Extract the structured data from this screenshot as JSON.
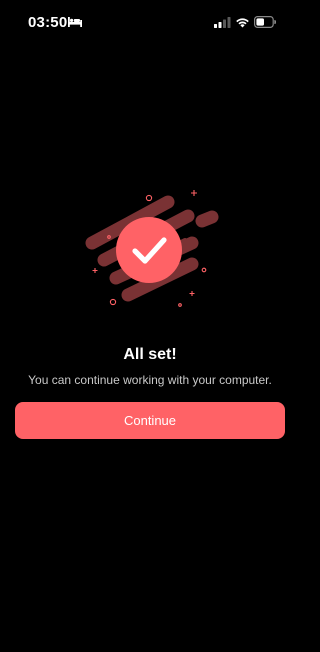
{
  "status_bar": {
    "time": "03:50",
    "icons": [
      "bed-icon",
      "cellular-signal-icon",
      "wifi-icon",
      "battery-icon"
    ]
  },
  "illustration": {
    "icon": "checkmark-icon",
    "accent_color": "#ff6266",
    "stripe_color": "#7a3234"
  },
  "main": {
    "title": "All set!",
    "subtitle": "You can continue working with your computer.",
    "continue_label": "Continue"
  },
  "colors": {
    "background": "#000000",
    "accent": "#ff6266",
    "text_primary": "#ffffff",
    "text_secondary": "#c9c9c9"
  }
}
